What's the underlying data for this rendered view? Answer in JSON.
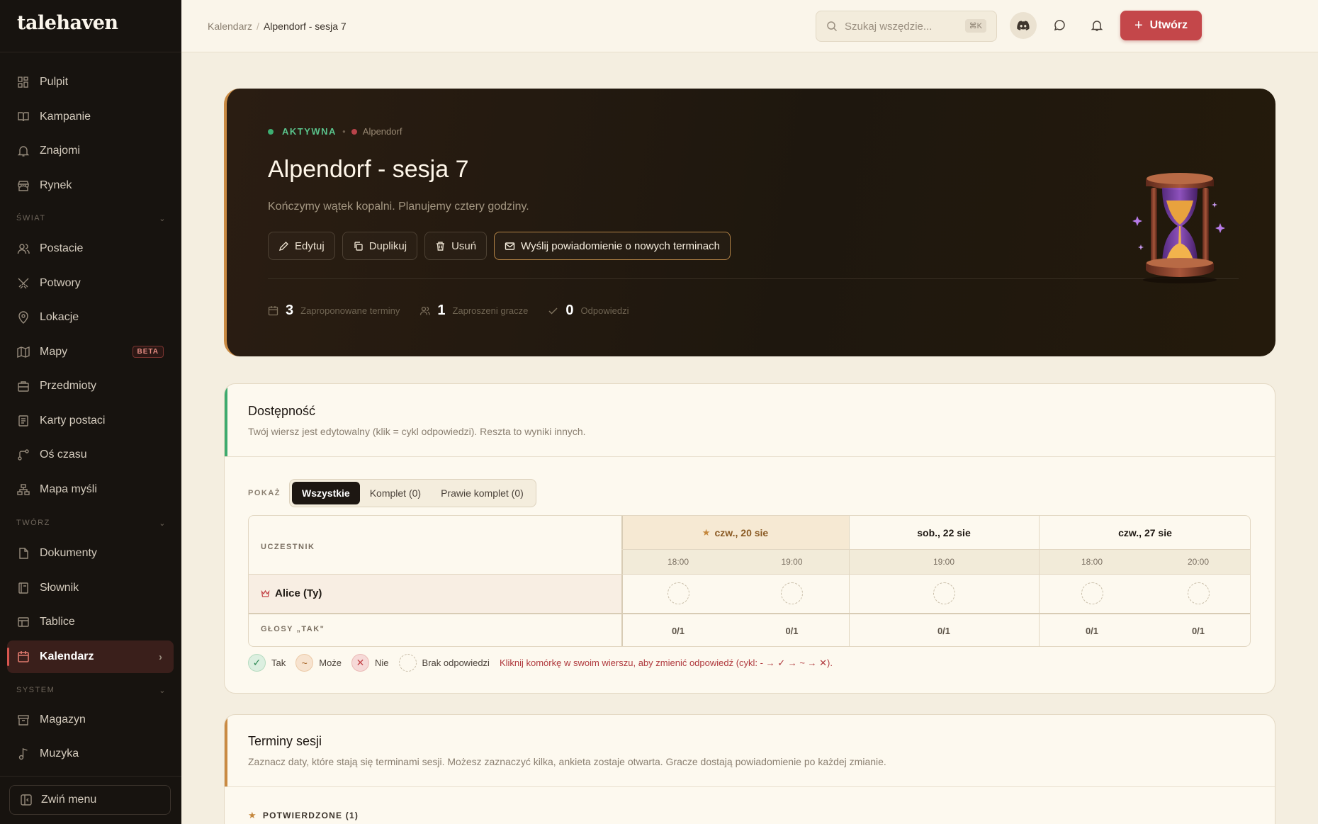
{
  "app": {
    "logo": "talehaven"
  },
  "sidebar": {
    "items": [
      {
        "label": "Pulpit",
        "icon": "dashboard-icon"
      },
      {
        "label": "Kampanie",
        "icon": "book-icon"
      },
      {
        "label": "Znajomi",
        "icon": "bell-icon"
      },
      {
        "label": "Rynek",
        "icon": "store-icon"
      }
    ],
    "sections": {
      "world": {
        "label": "ŚWIAT",
        "items": [
          {
            "label": "Postacie"
          },
          {
            "label": "Potwory"
          },
          {
            "label": "Lokacje"
          },
          {
            "label": "Mapy",
            "badge": "BETA"
          },
          {
            "label": "Przedmioty"
          },
          {
            "label": "Karty postaci"
          },
          {
            "label": "Oś czasu"
          },
          {
            "label": "Mapa myśli"
          }
        ]
      },
      "create": {
        "label": "TWÓRZ",
        "items": [
          {
            "label": "Dokumenty"
          },
          {
            "label": "Słownik"
          },
          {
            "label": "Tablice"
          },
          {
            "label": "Kalendarz",
            "active": true
          }
        ]
      },
      "system": {
        "label": "SYSTEM",
        "items": [
          {
            "label": "Magazyn"
          },
          {
            "label": "Muzyka"
          }
        ]
      }
    },
    "collapse_label": "Zwiń menu"
  },
  "topbar": {
    "breadcrumb": [
      "Kalendarz",
      "Alpendorf - sesja 7"
    ],
    "search_placeholder": "Szukaj wszędzie...",
    "search_shortcut": "⌘K",
    "create_label": "Utwórz",
    "accent": "#c4474a"
  },
  "hero": {
    "status": "AKTYWNA",
    "campaign": "Alpendorf",
    "title": "Alpendorf - sesja 7",
    "description": "Kończymy wątek kopalni. Planujemy cztery godziny.",
    "buttons": {
      "edit": "Edytuj",
      "duplicate": "Duplikuj",
      "delete": "Usuń",
      "notify": "Wyślij powiadomienie o nowych terminach"
    },
    "stats": [
      {
        "value": "3",
        "label": "Zaproponowane terminy"
      },
      {
        "value": "1",
        "label": "Zaproszeni gracze"
      },
      {
        "value": "0",
        "label": "Odpowiedzi"
      }
    ]
  },
  "availability": {
    "title": "Dostępność",
    "subtitle": "Twój wiersz jest edytowalny (klik = cykl odpowiedzi). Reszta to wyniki innych.",
    "filter_label": "POKAŻ",
    "filters": [
      "Wszystkie",
      "Komplet (0)",
      "Prawie komplet (0)"
    ],
    "participant_header": "UCZESTNIK",
    "days": [
      {
        "label": "czw., 20 sie",
        "starred": true,
        "times": [
          "18:00",
          "19:00"
        ]
      },
      {
        "label": "sob., 22 sie",
        "times": [
          "19:00"
        ]
      },
      {
        "label": "czw., 27 sie",
        "times": [
          "18:00",
          "20:00"
        ]
      }
    ],
    "participant": "Alice (Ty)",
    "votes_label": "GŁOSY „TAK\"",
    "votes": [
      "0/1",
      "0/1",
      "0/1",
      "0/1",
      "0/1"
    ],
    "legend": {
      "yes": "Tak",
      "maybe": "Może",
      "no": "Nie",
      "none": "Brak odpowiedzi"
    },
    "hint": "Kliknij komórkę w swoim wierszu, aby zmienić odpowiedź (cykl: - → ✓ → ~ → ✕)."
  },
  "sessions": {
    "title": "Terminy sesji",
    "subtitle": "Zaznacz daty, które stają się terminami sesji. Możesz zaznaczyć kilka, ankieta zostaje otwarta. Gracze dostają powiadomienie po każdej zmianie.",
    "confirmed_label": "POTWIERDZONE (1)"
  }
}
